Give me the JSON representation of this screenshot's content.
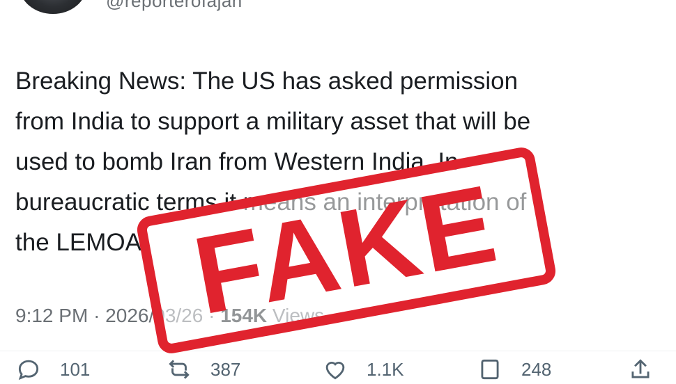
{
  "tweet": {
    "handle": "@reporterofajan",
    "text_lines": [
      "Breaking News: The US has asked permission",
      "from India to support a military asset that will be",
      "used to bomb Iran from Western India. In",
      "bureaucratic terms it means an interpretation of",
      "the LEMOA."
    ],
    "time": "9:12 PM",
    "separator": "·",
    "date": "2026/03/26",
    "views_count": "154K",
    "views_label": "Views"
  },
  "actions": {
    "reply_count": "101",
    "repost_count": "387",
    "like_count": "1.1K",
    "bookmark_count": "248"
  },
  "stamp": {
    "text": "FAKE",
    "color": "#e0232e"
  },
  "colors": {
    "text": "#1a1d21",
    "muted": "#6b7075",
    "icon": "#536471"
  }
}
